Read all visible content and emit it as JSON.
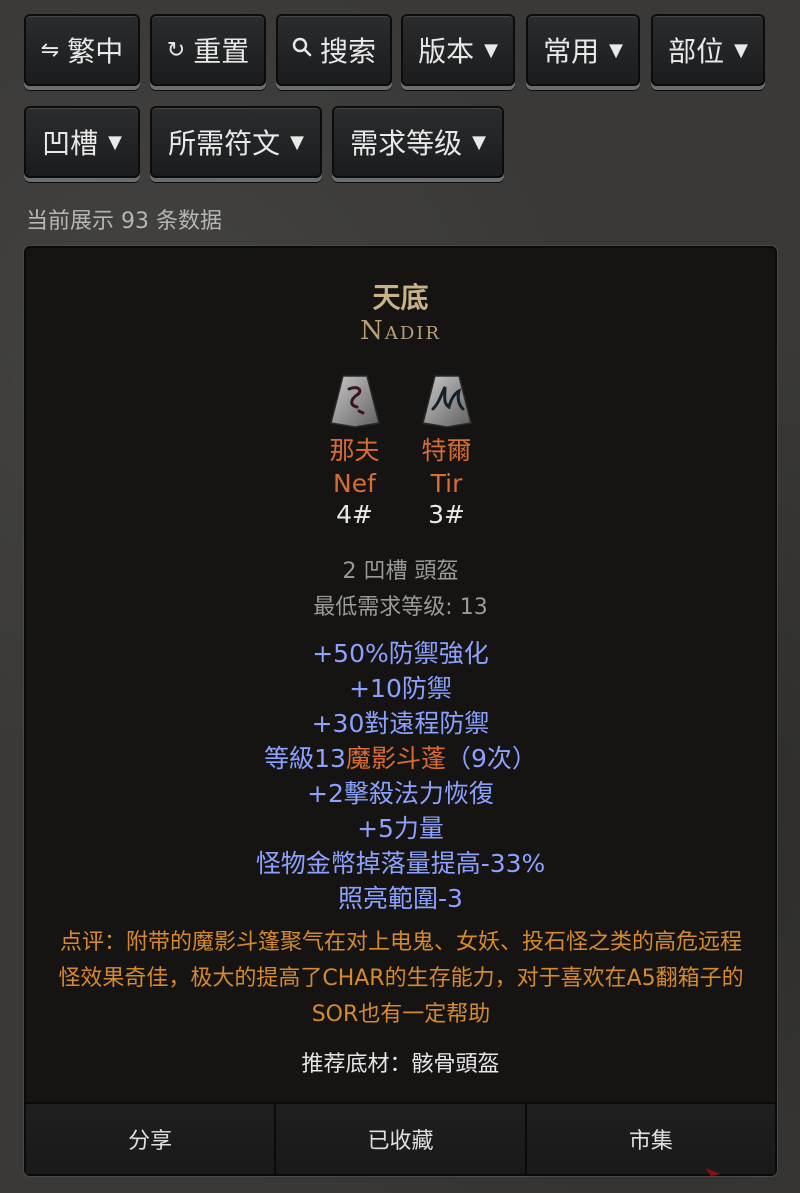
{
  "toolbar": {
    "row1": [
      {
        "icon": "swap-icon",
        "glyph": "⇋",
        "label": "繁中"
      },
      {
        "icon": "refresh-icon",
        "glyph": "↻",
        "label": "重置"
      },
      {
        "icon": "search-icon",
        "glyph": "🔍︎",
        "label": "搜索"
      },
      {
        "label": "版本"
      },
      {
        "label": "常用"
      },
      {
        "label": "部位"
      }
    ],
    "row2": [
      {
        "label": "凹槽"
      },
      {
        "label": "所需符文"
      },
      {
        "label": "需求等级"
      }
    ]
  },
  "count_text": "当前展示 93 条数据",
  "card": {
    "title_cn": "天底",
    "title_en": "Nadir",
    "runes": [
      {
        "cn": "那夫",
        "en": "Nef",
        "num": "4#",
        "icon": "rune-nef-icon"
      },
      {
        "cn": "特爾",
        "en": "Tir",
        "num": "3#",
        "icon": "rune-tir-icon"
      }
    ],
    "sockets": "2 凹槽 頭盔",
    "min_level": "最低需求等级: 13",
    "stats": [
      "+50%防禦強化",
      "+10防禦",
      "+30對遠程防禦",
      "",
      "+2擊殺法力恢復",
      "+5力量",
      "怪物金幣掉落量提高-33%",
      "照亮範圍-3"
    ],
    "skill_line": {
      "prefix": "等級13",
      "skill": "魔影斗蓬",
      "suffix": "（9次）"
    },
    "comment": "点评：附带的魔影斗篷聚气在对上电鬼、女妖、投石怪之类的高危远程怪效果奇佳，极大的提高了CHAR的生存能力，对于喜欢在A5翻箱子的SOR也有一定帮助",
    "recommend": "推荐底材：骸骨頭盔",
    "actions": [
      "分享",
      "已收藏",
      "市集"
    ]
  },
  "colors": {
    "title": "#c8b286",
    "rune_name": "#d86c36",
    "stat": "#8da1ff",
    "comment": "#d68a2f"
  }
}
